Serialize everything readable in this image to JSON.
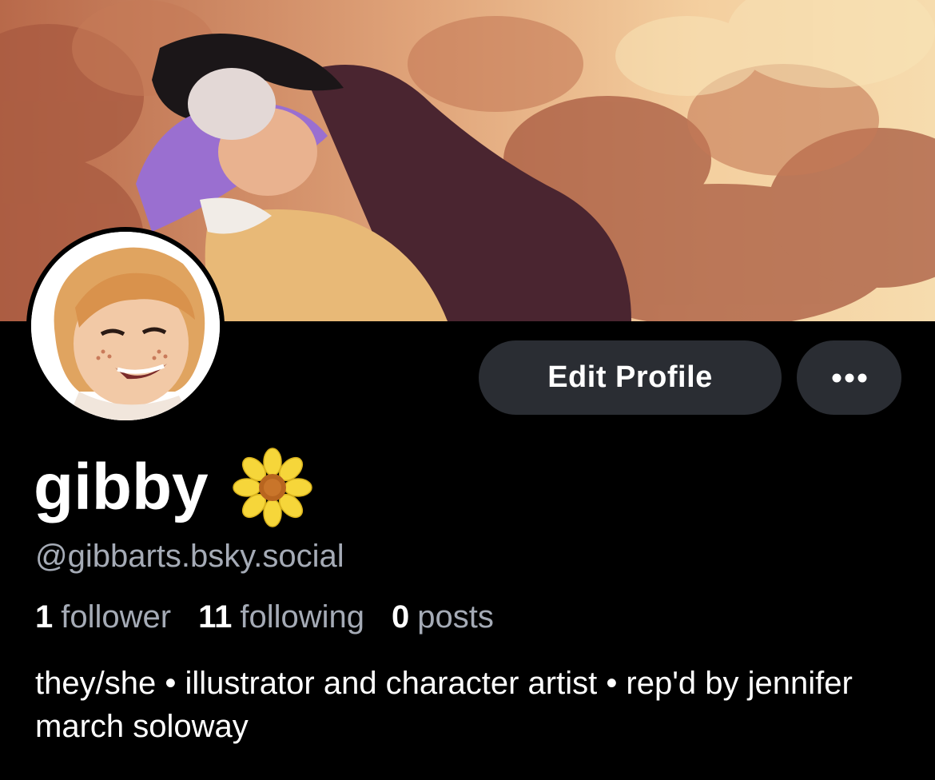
{
  "profile": {
    "display_name": "gibby",
    "name_emoji": "sunflower-icon",
    "handle": "@gibbarts.bsky.social",
    "bio": "they/she • illustrator and character artist • rep'd by jennifer march soloway"
  },
  "actions": {
    "edit_label": "Edit Profile",
    "more_icon": "ellipsis-icon"
  },
  "stats": {
    "followers_count": "1",
    "followers_label": "follower",
    "following_count": "11",
    "following_label": "following",
    "posts_count": "0",
    "posts_label": "posts"
  },
  "colors": {
    "background": "#000000",
    "button_bg": "#2a2d33",
    "muted_text": "#a5abb6"
  }
}
